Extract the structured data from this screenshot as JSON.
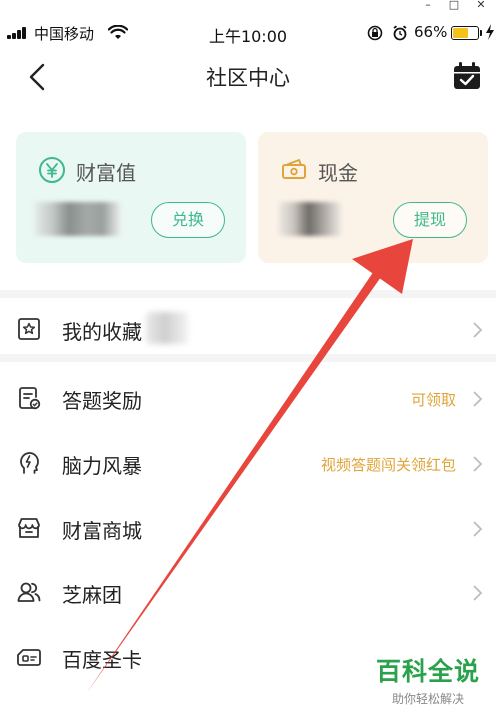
{
  "window": {
    "minimize": "–",
    "maximize": "□",
    "close": "✕"
  },
  "status_bar": {
    "carrier": "中国移动",
    "time": "上午10:00",
    "battery_percent": "66%",
    "battery_level": 0.66,
    "battery_color": "#f4c21b"
  },
  "nav": {
    "title": "社区中心",
    "back_icon": "chevron-left-icon",
    "right_icon": "calendar-check-icon"
  },
  "cards": {
    "wealth": {
      "icon": "yen-coin-icon",
      "title": "财富值",
      "button": "兑换",
      "bg": "#e9f8f3"
    },
    "cash": {
      "icon": "cash-bill-icon",
      "title": "现金",
      "button": "提现",
      "bg": "#fcf3e8"
    }
  },
  "accent_color": "#3fb88f",
  "hint_color": "#e0a43a",
  "menu": [
    {
      "icon": "star-badge-icon",
      "label": "我的收藏",
      "hint": ""
    },
    {
      "icon": "quiz-document-icon",
      "label": "答题奖励",
      "hint": "可领取"
    },
    {
      "icon": "brain-bolt-icon",
      "label": "脑力风暴",
      "hint": "视频答题闯关领红包"
    },
    {
      "icon": "store-icon",
      "label": "财富商城",
      "hint": ""
    },
    {
      "icon": "group-people-icon",
      "label": "芝麻团",
      "hint": ""
    },
    {
      "icon": "card-icon",
      "label": "百度圣卡",
      "hint": ""
    }
  ],
  "watermark": {
    "title": "百科全说",
    "subtitle": "助你轻松解决"
  },
  "annotation": {
    "arrow_color": "#e8453c"
  }
}
